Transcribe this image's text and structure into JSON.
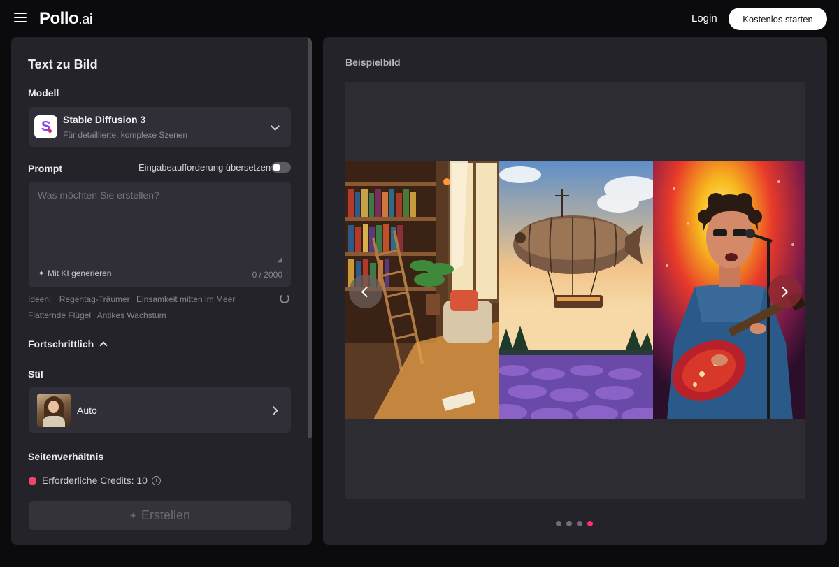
{
  "header": {
    "logo_main": "Pollo",
    "logo_suffix": ".ai",
    "login": "Login",
    "start_button": "Kostenlos starten"
  },
  "left": {
    "title": "Text zu Bild",
    "model_label": "Modell",
    "model": {
      "logo_letter": "S",
      "name": "Stable Diffusion 3",
      "description": "Für detaillierte, komplexe Szenen"
    },
    "prompt_label": "Prompt",
    "translate_label": "Eingabeaufforderung übersetzen",
    "translate_enabled": false,
    "prompt_placeholder": "Was möchten Sie erstellen?",
    "prompt_value": "",
    "ai_generate": "Mit KI generieren",
    "counter": "0 / 2000",
    "ideas_label": "Ideen:",
    "ideas": [
      "Regentag-Träumer",
      "Einsamkeit mitten im Meer",
      "Flatternde Flügel",
      "Antikes Wachstum"
    ],
    "advanced_label": "Fortschrittlich",
    "style_label": "Stil",
    "style_value": "Auto",
    "aspect_label": "Seitenverhältnis",
    "credits": "Erforderliche Credits: 10",
    "create_button": "Erstellen"
  },
  "right": {
    "example_label": "Beispielbild",
    "carousel_images": [
      "cozy-library-room",
      "steampunk-airship-over-lavender",
      "guitarist-pop-art"
    ],
    "carousel_dots": 4,
    "active_dot": 3
  },
  "colors": {
    "accent": "#ff2f6e",
    "panel": "#242329",
    "card": "#302f37",
    "background": "#0b0b0d"
  }
}
